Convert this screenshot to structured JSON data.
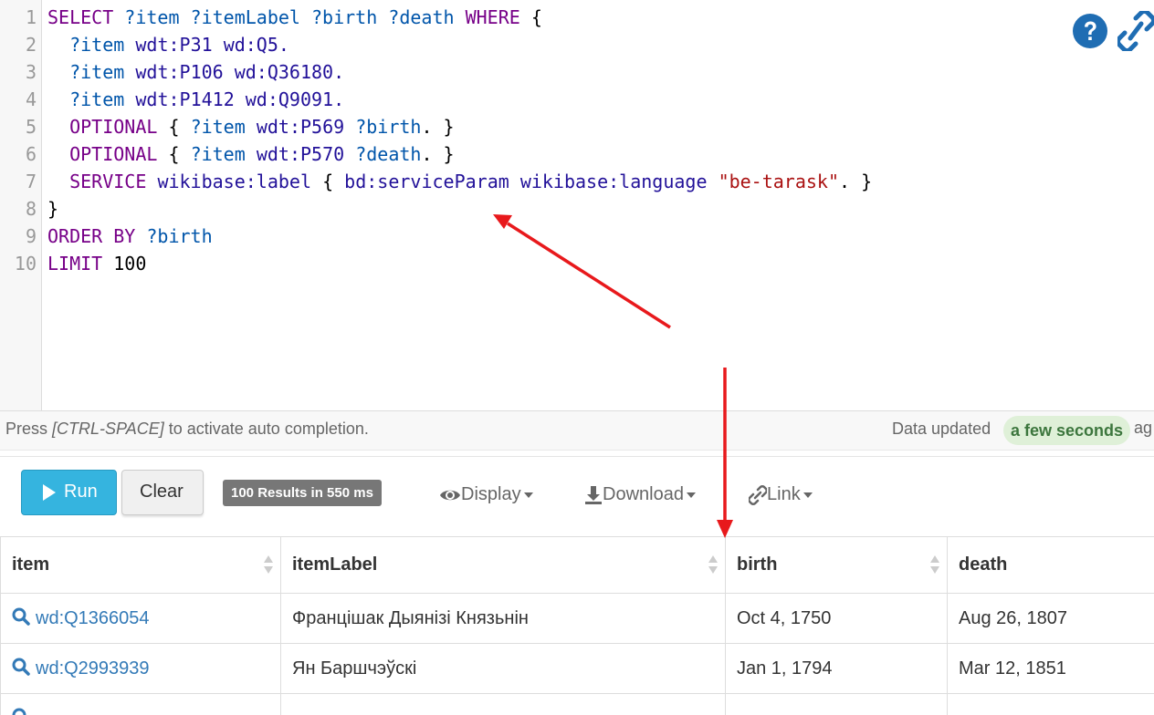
{
  "editor": {
    "line_numbers": [
      "1",
      "2",
      "3",
      "4",
      "5",
      "6",
      "7",
      "8",
      "9",
      "10"
    ],
    "query": {
      "l1_select": "SELECT",
      "l1_vars": "?item ?itemLabel ?birth ?death",
      "l1_where": "WHERE",
      "l1_brace": "{",
      "l2_var": "?item",
      "l2_rest": "wdt:P31 wd:Q5.",
      "l3_var": "?item",
      "l3_rest": "wdt:P106 wd:Q36180.",
      "l4_var": "?item",
      "l4_rest": "wdt:P1412 wd:Q9091.",
      "l5_kw": "OPTIONAL",
      "l5_open": "{",
      "l5_var": "?item",
      "l5_pred": "wdt:P569",
      "l5_obj": "?birth",
      "l5_close": ". }",
      "l6_kw": "OPTIONAL",
      "l6_open": "{",
      "l6_var": "?item",
      "l6_pred": "wdt:P570",
      "l6_obj": "?death",
      "l6_close": ". }",
      "l7_kw": "SERVICE",
      "l7_label": "wikibase:label",
      "l7_open": "{",
      "l7_param": "bd:serviceParam wikibase:language",
      "l7_str": "\"be-tarask\"",
      "l7_close": ". }",
      "l8_close": "}",
      "l9_kw": "ORDER BY",
      "l9_var": "?birth",
      "l10_kw": "LIMIT",
      "l10_num": "100"
    }
  },
  "status": {
    "hint_prefix": "Press",
    "hint_keys": "[CTRL-SPACE]",
    "hint_suffix": "to activate auto completion.",
    "updated_label": "Data updated",
    "updated_badge": "a few seconds",
    "updated_suffix": "ag"
  },
  "toolbar": {
    "run_label": "Run",
    "clear_label": "Clear",
    "results_badge": "100 Results in 550 ms",
    "display_label": "Display",
    "download_label": "Download",
    "link_label": "Link"
  },
  "table": {
    "headers": [
      "item",
      "itemLabel",
      "birth",
      "death"
    ],
    "rows": [
      {
        "item": "wd:Q1366054",
        "label": "Францішак Дыянізі Князьнін",
        "birth": "Oct 4, 1750",
        "death": "Aug 26, 1807"
      },
      {
        "item": "wd:Q2993939",
        "label": "Ян Баршчэўскі",
        "birth": "Jan 1, 1794",
        "death": "Mar 12, 1851"
      }
    ]
  },
  "icons": {
    "help": "question-circle-icon",
    "share": "link-chain-icon",
    "search": "magnifier-icon",
    "eye": "eye-icon",
    "download": "download-icon",
    "link": "link-icon"
  },
  "colors": {
    "run_button": "#35b4df",
    "keyword": "#770088",
    "variable": "#0055aa",
    "prefixed_name": "#221199",
    "string": "#aa1111",
    "annotation_arrow": "#e8191c",
    "badge_green_bg": "#dff0d8"
  }
}
